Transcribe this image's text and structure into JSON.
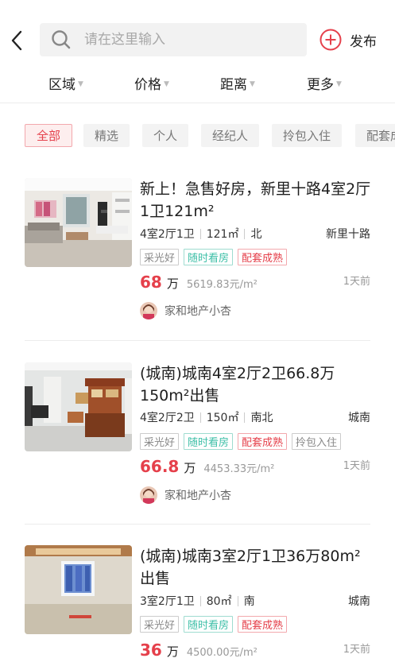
{
  "header": {
    "search_placeholder": "请在这里输入",
    "publish_label": "发布"
  },
  "filters": [
    {
      "label": "区域"
    },
    {
      "label": "价格"
    },
    {
      "label": "距离"
    },
    {
      "label": "更多"
    }
  ],
  "chips": [
    {
      "label": "全部",
      "active": true
    },
    {
      "label": "精选"
    },
    {
      "label": "个人"
    },
    {
      "label": "经纪人"
    },
    {
      "label": "拎包入住"
    },
    {
      "label": "配套成"
    }
  ],
  "listings": [
    {
      "title": "新上！急售好房，新里十路4室2厅1卫121m²",
      "rooms": "4室2厅1卫",
      "area": "121㎡",
      "orientation": "北",
      "location": "新里十路",
      "tags": [
        "采光好",
        "随时看房",
        "配套成熟"
      ],
      "price": "68",
      "price_unit": "万",
      "price_per_sqm": "5619.83元/m²",
      "time": "1天前",
      "agent": "家和地产小杏"
    },
    {
      "title": "(城南)城南4室2厅2卫66.8万150m²出售",
      "rooms": "4室2厅2卫",
      "area": "150㎡",
      "orientation": "南北",
      "location": "城南",
      "tags": [
        "采光好",
        "随时看房",
        "配套成熟",
        "拎包入住"
      ],
      "price": "66.8",
      "price_unit": "万",
      "price_per_sqm": "4453.33元/m²",
      "time": "1天前",
      "agent": "家和地产小杏"
    },
    {
      "title": "(城南)城南3室2厅1卫36万80m²出售",
      "rooms": "3室2厅1卫",
      "area": "80㎡",
      "orientation": "南",
      "location": "城南",
      "tags": [
        "采光好",
        "随时看房",
        "配套成熟"
      ],
      "price": "36",
      "price_unit": "万",
      "price_per_sqm": "4500.00元/m²",
      "time": "1天前"
    }
  ],
  "colors": {
    "accent_red": "#e5404b",
    "accent_green": "#3dbfa7"
  }
}
